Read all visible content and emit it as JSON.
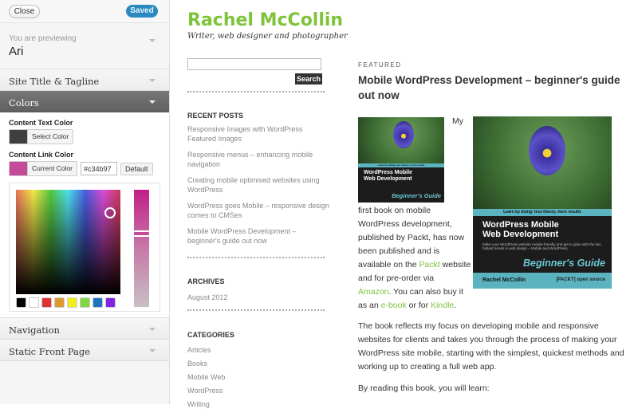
{
  "customizer": {
    "close_label": "Close",
    "saved_label": "Saved",
    "previewing_label": "You are previewing",
    "theme_name": "Ari",
    "sections": {
      "site_title": "Site Title & Tagline",
      "colors": "Colors",
      "navigation": "Navigation",
      "static_front_page": "Static Front Page"
    },
    "colors": {
      "content_text_label": "Content Text Color",
      "content_text_swatch": "#3f3f3f",
      "select_color_label": "Select Color",
      "content_link_label": "Content Link Color",
      "content_link_swatch": "#c34b97",
      "current_color_label": "Current Color",
      "hex_value": "#c34b97",
      "default_label": "Default",
      "palette": [
        "#000000",
        "#ffffff",
        "#dd3333",
        "#dd9933",
        "#eeee22",
        "#81d742",
        "#1e73be",
        "#8224e3"
      ]
    }
  },
  "site": {
    "title": "Rachel McCollin",
    "tagline": "Writer, web designer and photographer",
    "search_placeholder": "",
    "search_button": "Search",
    "recent_posts_title": "RECENT POSTS",
    "recent_posts": [
      "Responsive Images with WordPress Featured Images",
      "Responsive menus – enhancing mobile navigation",
      "Creating mobile optimised websites using WordPress",
      "WordPress goes Mobile – responsive design comes to CMSes",
      "Mobile WordPress Development – beginner's guide out now"
    ],
    "archives_title": "ARCHIVES",
    "archives": [
      "August 2012"
    ],
    "categories_title": "CATEGORIES",
    "categories": [
      "Articles",
      "Books",
      "Mobile Web",
      "WordPress",
      "Writing"
    ],
    "post": {
      "label": "FEATURED",
      "title": "Mobile WordPress Development – beginner's guide out now",
      "para1_start": "My",
      "para1_lines": {
        "a": "first book on mobile",
        "b": "WordPress development,",
        "c": "published by Packt, has now",
        "d": "been published and is",
        "e_pre": "available on the ",
        "e_link": "Packt",
        "e_post": " website",
        "f": "and for pre-order via",
        "g_link": "Amazon",
        "g_post": ". You can also buy it",
        "h_pre": "as an ",
        "h_link1": "e-book",
        "h_mid": " or for ",
        "h_link2": "Kindle",
        "h_post": "."
      },
      "para2": "The book reflects my focus on developing mobile and responsive websites for clients and takes you through the process of making your WordPress site mobile, starting with the simplest, quickest methods and working up to creating a full web app.",
      "para3": "By reading this book, you will learn:"
    },
    "book_cover": {
      "band_text": "Learn by doing: less theory, more results",
      "title_line1": "WordPress Mobile",
      "title_line2": "Web Development",
      "blurb": "Make your WordPress website mobile-friendly and get to grips with the two hottest trends in web design – Mobile and WordPress.",
      "series": "Beginner's Guide",
      "author": "Rachel McCollin",
      "publisher": "[PACKT] open source"
    },
    "link_color": "#7ec43a"
  }
}
